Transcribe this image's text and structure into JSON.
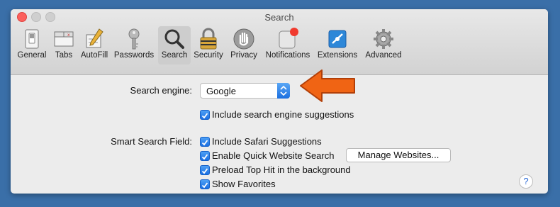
{
  "window": {
    "title": "Search"
  },
  "toolbar": {
    "items": [
      {
        "label": "General",
        "icon": "general-switch-icon"
      },
      {
        "label": "Tabs",
        "icon": "tabs-icon"
      },
      {
        "label": "AutoFill",
        "icon": "pencil-form-icon"
      },
      {
        "label": "Passwords",
        "icon": "key-icon"
      },
      {
        "label": "Search",
        "icon": "magnifying-glass-icon",
        "selected": true
      },
      {
        "label": "Security",
        "icon": "padlock-icon"
      },
      {
        "label": "Privacy",
        "icon": "hand-icon"
      },
      {
        "label": "Notifications",
        "icon": "notification-badge-icon"
      },
      {
        "label": "Extensions",
        "icon": "puzzle-icon"
      },
      {
        "label": "Advanced",
        "icon": "gear-icon"
      }
    ]
  },
  "search": {
    "engine_label": "Search engine:",
    "engine_value": "Google",
    "include_suggestions": {
      "label": "Include search engine suggestions",
      "checked": true
    }
  },
  "smart_field": {
    "label": "Smart Search Field:",
    "options": [
      {
        "label": "Include Safari Suggestions",
        "checked": true
      },
      {
        "label": "Enable Quick Website Search",
        "checked": true
      },
      {
        "label": "Preload Top Hit in the background",
        "checked": true
      },
      {
        "label": "Show Favorites",
        "checked": true
      }
    ],
    "manage_button": "Manage Websites..."
  },
  "help": "?",
  "colors": {
    "accent": "#1a6fe3",
    "arrow": "#f06414",
    "background": "#3a6fa8"
  }
}
